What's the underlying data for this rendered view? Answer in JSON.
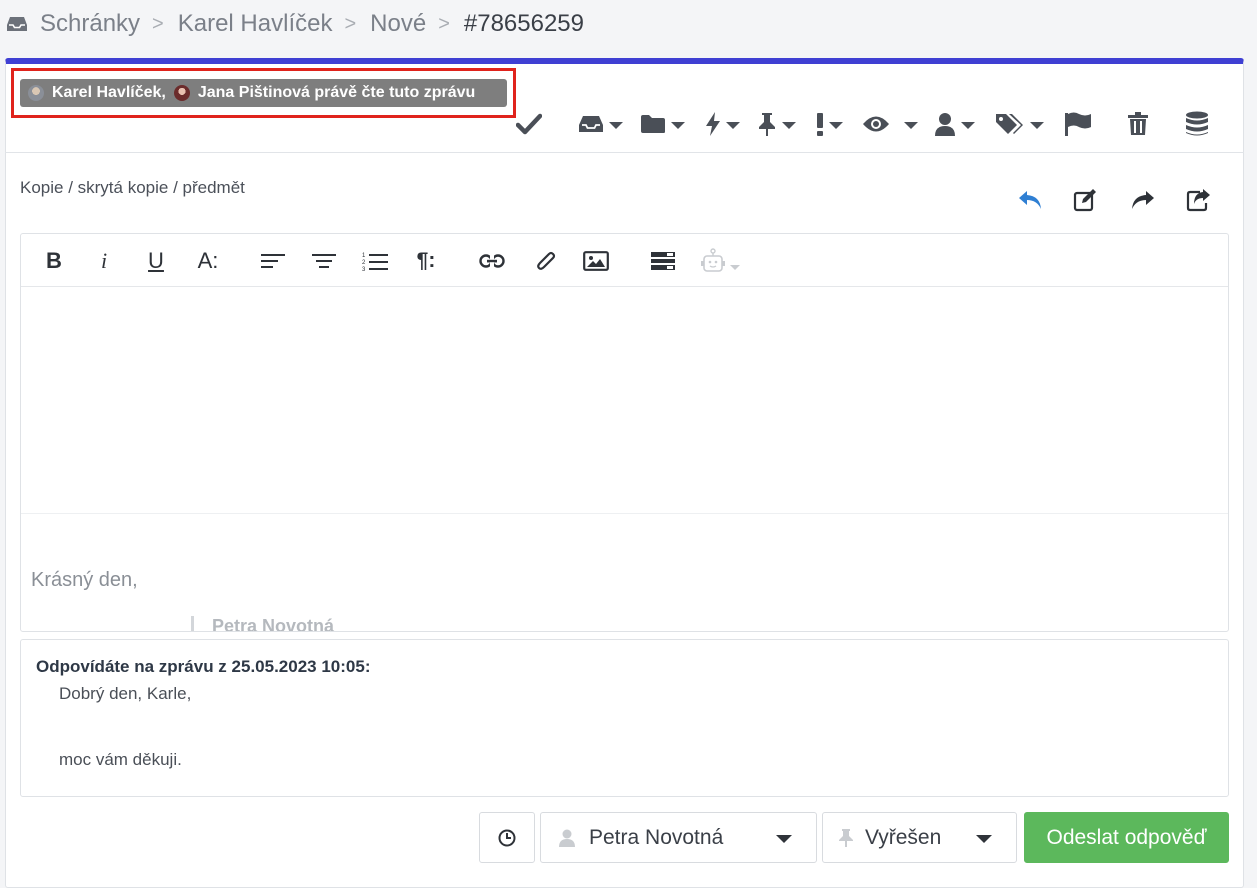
{
  "breadcrumb": {
    "items": [
      "Schránky",
      "Karel Havlíček",
      "Nové"
    ],
    "separator": ">",
    "ticket_id": "#78656259"
  },
  "viewers": {
    "names": "Karel Havlíček,",
    "text": "Jana Pištinová právě čte tuto zprávu"
  },
  "toolbar": {
    "icons": [
      "check-icon",
      "inbox-icon",
      "folder-icon",
      "bolt-icon",
      "pin-icon",
      "exclamation-icon",
      "eye-icon",
      "user-icon",
      "tags-icon",
      "flag-icon",
      "trash-icon",
      "database-icon"
    ]
  },
  "compose": {
    "cc_label": "Kopie / skrytá kopie / předmět",
    "signature_greeting": "Krásný den,",
    "signature_name": "Petra Novotná"
  },
  "format_bar": {
    "bold": "B",
    "italic": "i",
    "underline": "U",
    "font_size": "A:",
    "paragraph": "¶:"
  },
  "quote": {
    "header": "Odpovídáte na zprávu z 25.05.2023 10:05:",
    "line1": "Dobrý den, Karle,",
    "line2": "moc vám děkuji."
  },
  "footer": {
    "assignee": "Petra Novotná",
    "status": "Vyřešen",
    "send_label": "Odeslat odpověď"
  },
  "colors": {
    "accent_bar": "#3f3fd3",
    "highlight_border": "#e0231c",
    "send_button": "#5cb85c",
    "reply_icon": "#2f7fd3"
  }
}
